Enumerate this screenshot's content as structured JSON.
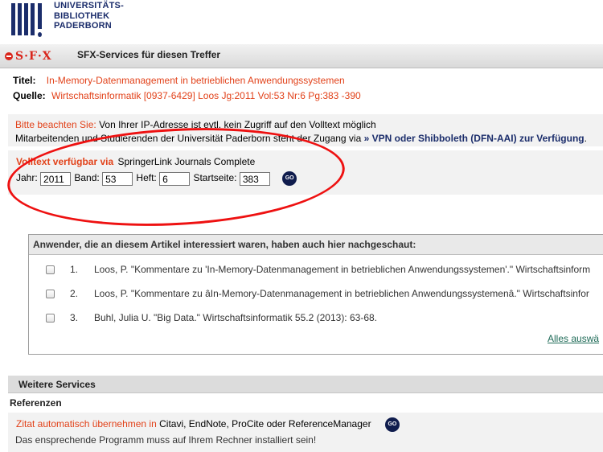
{
  "header": {
    "logo_line1": "UNIVERSITÄTS-",
    "logo_line2": "BIBLIOTHEK",
    "logo_line3": "PADERBORN",
    "sfx_logo": "S·F·X",
    "title": "SFX-Services für diesen Treffer"
  },
  "record": {
    "title_label": "Titel:",
    "title_value": "In-Memory-Datenmanagement in betrieblichen Anwendungssystemen",
    "source_label": "Quelle:",
    "source_value": "Wirtschaftsinformatik [0937-6429] Loos Jg:2011 Vol:53 Nr:6 Pg:383 -390"
  },
  "notice": {
    "prefix": "Bitte beachten Sie:",
    "line1": "Von Ihrer IP-Adresse ist evtl. kein Zugriff auf den Volltext möglich",
    "line2_start": "Mitarbeitenden und Studierenden der Universität Paderborn steht der Zugang via",
    "line2_bold": "» VPN oder Shibboleth (DFN-AAI) zur Verfügung",
    "line2_end": "."
  },
  "fulltext": {
    "prefix": "Volltext verfügbar via",
    "provider": "SpringerLink Journals Complete",
    "year_label": "Jahr:",
    "year_value": "2011",
    "volume_label": "Band:",
    "volume_value": "53",
    "issue_label": "Heft:",
    "issue_value": "6",
    "startpage_label": "Startseite:",
    "startpage_value": "383",
    "go_label": "GO"
  },
  "recommendations": {
    "heading": "Anwender, die an diesem Artikel interessiert waren, haben auch hier nachgeschaut:",
    "items": [
      {
        "num": "1.",
        "text": "Loos, P. \"Kommentare zu 'In-Memory-Datenmanagement in betrieblichen Anwendungssystemen'.\" Wirtschaftsinform"
      },
      {
        "num": "2.",
        "text": "Loos, P. \"Kommentare zu âIn-Memory-Datenmanagement in betrieblichen Anwendungssystemenâ.\" Wirtschaftsinfor"
      },
      {
        "num": "3.",
        "text": "Buhl, Julia U. \"Big Data.\" Wirtschaftsinformatik 55.2 (2013): 63-68."
      }
    ],
    "select_all": "Alles auswä"
  },
  "more_services": {
    "heading": "Weitere Services",
    "references_heading": "Referenzen",
    "cite_prefix": "Zitat automatisch übernehmen in",
    "cite_targets": "Citavi, EndNote, ProCite oder ReferenceManager",
    "cite_note": "Das ensprechende Programm muss auf Ihrem Rechner installiert sein!",
    "go_label": "GO"
  },
  "colors": {
    "accent_red": "#e2421a",
    "brand_navy": "#1b2d6b",
    "annotation_red": "#e11111"
  }
}
